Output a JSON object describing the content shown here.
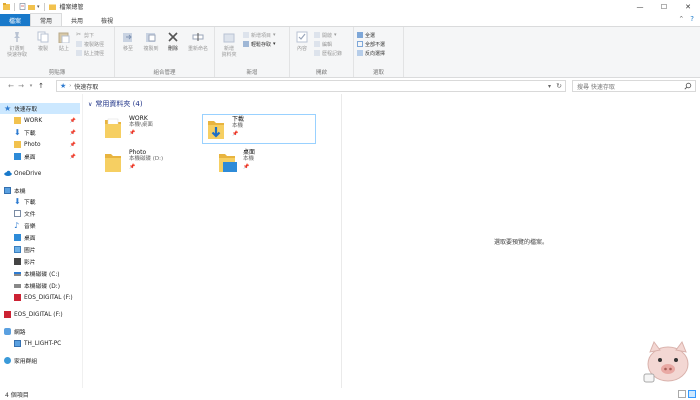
{
  "window": {
    "title": "檔案總管",
    "controls": [
      "minimize-icon",
      "maximize-icon",
      "close-icon"
    ]
  },
  "ribbon_tabs": [
    {
      "label": "檔案",
      "style": "file"
    },
    {
      "label": "常用",
      "style": "active"
    },
    {
      "label": "共用",
      "style": "normal"
    },
    {
      "label": "檢視",
      "style": "normal"
    }
  ],
  "ribbon": {
    "clipboard": {
      "label": "剪貼簿",
      "pin": "釘選到\n快速存取",
      "copy": "複製",
      "paste": "貼上",
      "cut": "剪下",
      "copy_path": "複製路徑",
      "paste_shortcut": "貼上捷徑"
    },
    "organize": {
      "label": "組合管理",
      "move_to": "移至",
      "copy_to": "複製到",
      "delete": "刪除",
      "rename": "重新命名"
    },
    "new": {
      "label": "新增",
      "new_folder": "新增\n資料夾",
      "new_item": "新增項目",
      "easy_access": "輕鬆存取"
    },
    "open": {
      "label": "開啟",
      "properties": "內容",
      "open": "開啟",
      "edit": "編輯",
      "history": "歷程記錄"
    },
    "select": {
      "label": "選取",
      "select_all": "全選",
      "select_none": "全部不選",
      "invert": "反向選擇"
    }
  },
  "address": {
    "path": "快速存取",
    "search_placeholder": "搜尋 快速存取"
  },
  "nav_pane": {
    "quick_access": "快速存取",
    "pinned": [
      {
        "label": "WORK",
        "icon": "folder-icon"
      },
      {
        "label": "下載",
        "icon": "download-icon"
      },
      {
        "label": "Photo",
        "icon": "folder-icon"
      },
      {
        "label": "桌面",
        "icon": "desktop-icon"
      }
    ],
    "onedrive": "OneDrive",
    "this_pc": "本機",
    "pc_items": [
      {
        "label": "下載",
        "icon": "download-icon"
      },
      {
        "label": "文件",
        "icon": "document-icon"
      },
      {
        "label": "音樂",
        "icon": "music-icon"
      },
      {
        "label": "桌面",
        "icon": "desktop-icon"
      },
      {
        "label": "圖片",
        "icon": "picture-icon"
      },
      {
        "label": "影片",
        "icon": "video-icon"
      },
      {
        "label": "本機磁碟 (C:)",
        "icon": "drive-icon"
      },
      {
        "label": "本機磁碟 (D:)",
        "icon": "drive-icon"
      },
      {
        "label": "EOS_DIGITAL (F:)",
        "icon": "sdcard-icon"
      }
    ],
    "eos": "EOS_DIGITAL (F:)",
    "network": "網路",
    "network_pc": "TH_LIGHT-PC",
    "homegroup": "家用群組"
  },
  "content": {
    "group_title": "常用資料夾 (4)",
    "tiles": [
      {
        "name": "WORK",
        "sub": "本機\\桌面"
      },
      {
        "name": "下載",
        "sub": "本機"
      },
      {
        "name": "Photo",
        "sub": "本機磁碟 (D:)"
      },
      {
        "name": "桌面",
        "sub": "本機"
      }
    ]
  },
  "preview": {
    "message": "選取要預覽的檔案。"
  },
  "status": {
    "count": "4 個項目"
  },
  "colors": {
    "accent": "#1979ca",
    "folder": "#f2c24e",
    "selection": "#cce8ff",
    "group_header": "#1e3287"
  }
}
